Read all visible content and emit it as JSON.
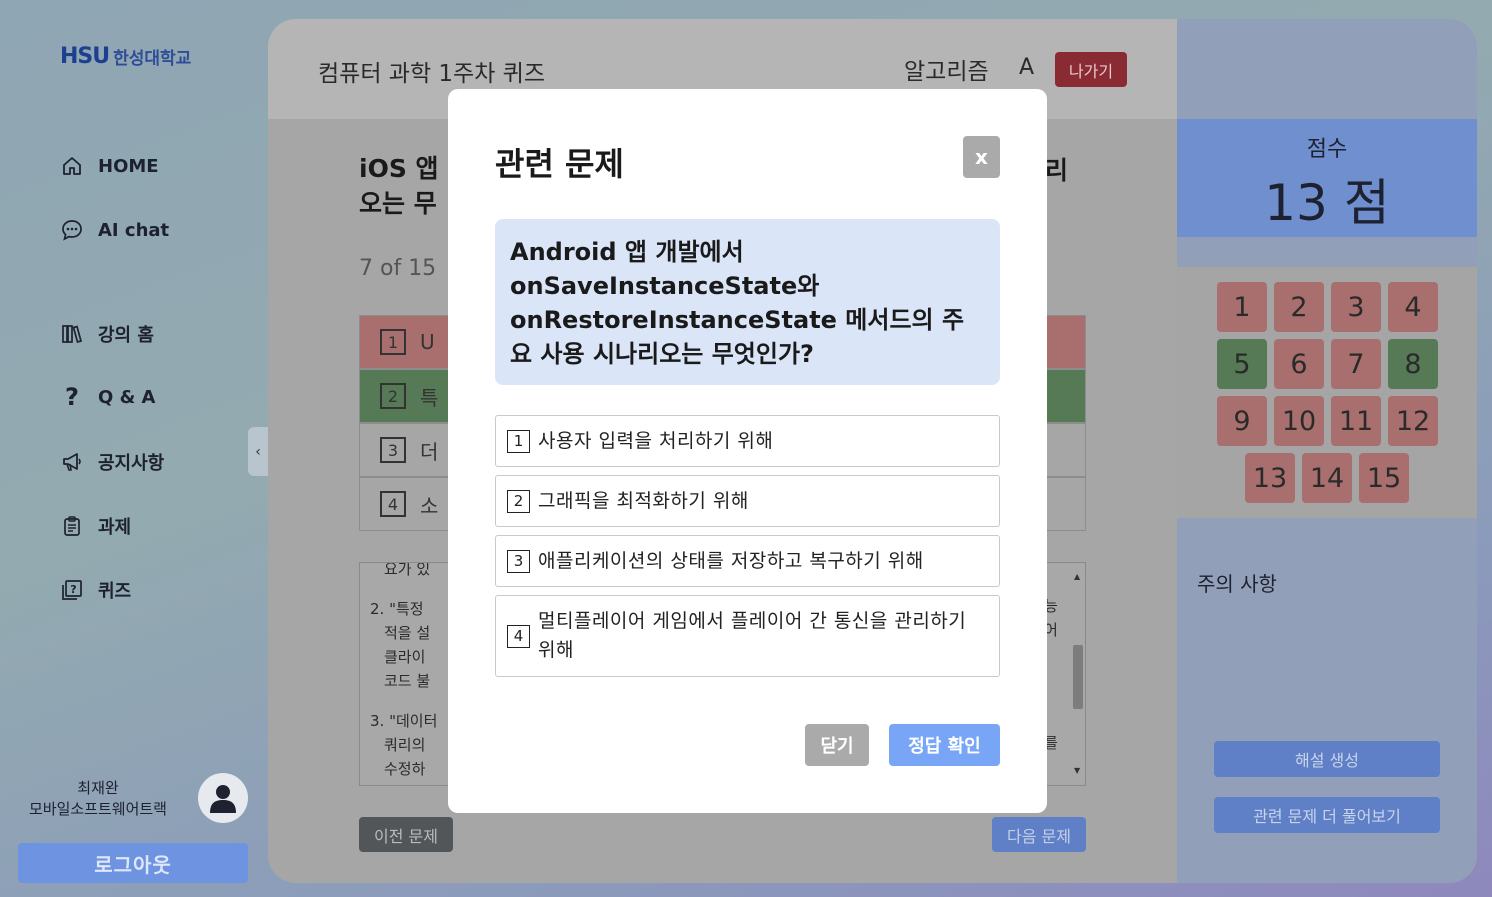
{
  "sidebar": {
    "logo_mark": "HSU",
    "logo_text": "한성대학교",
    "items": [
      {
        "label": "HOME",
        "icon": "home-icon"
      },
      {
        "label": "AI chat",
        "icon": "chat-icon"
      },
      {
        "label": "강의 홈",
        "icon": "books-icon"
      },
      {
        "label": "Q & A",
        "icon": "question-icon"
      },
      {
        "label": "공지사항",
        "icon": "megaphone-icon"
      },
      {
        "label": "과제",
        "icon": "clipboard-icon"
      },
      {
        "label": "퀴즈",
        "icon": "quiz-icon"
      }
    ],
    "collapse_icon": "‹",
    "user": {
      "name": "최재완",
      "track": "모바일소프트웨어트랙"
    },
    "logout_label": "로그아웃"
  },
  "header": {
    "quiz_title": "컴퓨터 과학 1주차 퀴즈",
    "subject": "알고리즘",
    "grade": "A",
    "exit_label": "나가기"
  },
  "question": {
    "title": "iOS 앱",
    "title_line2": "오는 무",
    "title_right": "리",
    "progress": "7 of 15",
    "options": [
      {
        "num": "1",
        "text": "U",
        "state": "wrong"
      },
      {
        "num": "2",
        "text": "특",
        "state": "correct"
      },
      {
        "num": "3",
        "text": "더",
        "state": "none"
      },
      {
        "num": "4",
        "text": "소",
        "state": "none"
      }
    ],
    "explanation": [
      "요가 있",
      "2. \"특정",
      "적을 설",
      "클라이",
      "코드 불",
      "3. \"데이터",
      "쿼리의",
      "수정하"
    ],
    "explanation_right": [
      "능",
      "어",
      "를"
    ],
    "prev_label": "이전 문제",
    "next_label": "다음 문제"
  },
  "score": {
    "label": "점수",
    "value": "13 점"
  },
  "question_grid": [
    {
      "n": "1",
      "state": "wrong"
    },
    {
      "n": "2",
      "state": "wrong"
    },
    {
      "n": "3",
      "state": "wrong"
    },
    {
      "n": "4",
      "state": "wrong"
    },
    {
      "n": "5",
      "state": "right"
    },
    {
      "n": "6",
      "state": "wrong"
    },
    {
      "n": "7",
      "state": "wrong"
    },
    {
      "n": "8",
      "state": "right"
    },
    {
      "n": "9",
      "state": "wrong"
    },
    {
      "n": "10",
      "state": "wrong"
    },
    {
      "n": "11",
      "state": "wrong"
    },
    {
      "n": "12",
      "state": "wrong"
    },
    {
      "n": "13",
      "state": "wrong"
    },
    {
      "n": "14",
      "state": "wrong"
    },
    {
      "n": "15",
      "state": "wrong"
    }
  ],
  "caution_label": "주의 사항",
  "generate_explanation_label": "해설 생성",
  "more_related_label": "관련 문제 더 풀어보기",
  "colors": {
    "wrong": "#a96f6f",
    "right": "#567a56",
    "accent": "#78a5f5",
    "exit": "#8a2b34"
  },
  "modal": {
    "title": "관련 문제",
    "close_x": "x",
    "question": "Android 앱 개발에서 onSaveInstanceState와 onRestoreInstanceState 메서드의 주요 사용 시나리오는 무엇인가?",
    "options": [
      {
        "num": "1",
        "text": "사용자 입력을 처리하기 위해"
      },
      {
        "num": "2",
        "text": "그래픽을 최적화하기 위해"
      },
      {
        "num": "3",
        "text": "애플리케이션의 상태를 저장하고 복구하기 위해"
      },
      {
        "num": "4",
        "text": "멀티플레이어 게임에서 플레이어 간 통신을 관리하기 위해"
      }
    ],
    "close_label": "닫기",
    "check_label": "정답 확인"
  }
}
